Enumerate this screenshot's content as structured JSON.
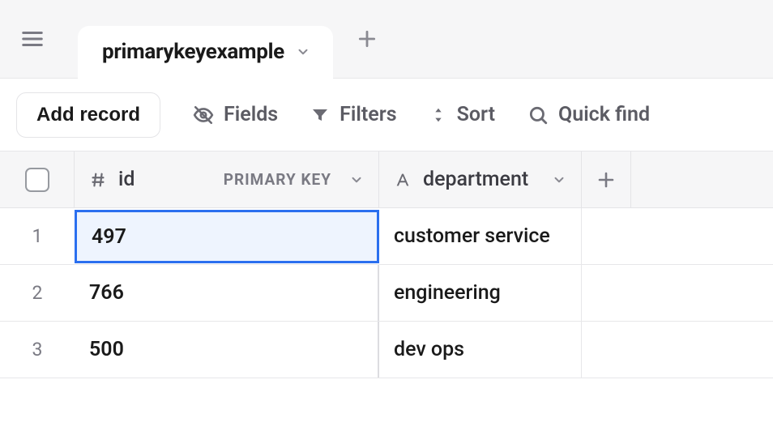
{
  "tab": {
    "label": "primarykeyexample"
  },
  "toolbar": {
    "add_record": "Add record",
    "fields": "Fields",
    "filters": "Filters",
    "sort": "Sort",
    "quick_find": "Quick find"
  },
  "columns": {
    "id": {
      "name": "id",
      "badge": "PRIMARY KEY"
    },
    "department": {
      "name": "department"
    }
  },
  "rows": [
    {
      "num": "1",
      "id": "497",
      "department": "customer service",
      "selected": true
    },
    {
      "num": "2",
      "id": "766",
      "department": "engineering",
      "selected": false
    },
    {
      "num": "3",
      "id": "500",
      "department": "dev ops",
      "selected": false
    }
  ]
}
